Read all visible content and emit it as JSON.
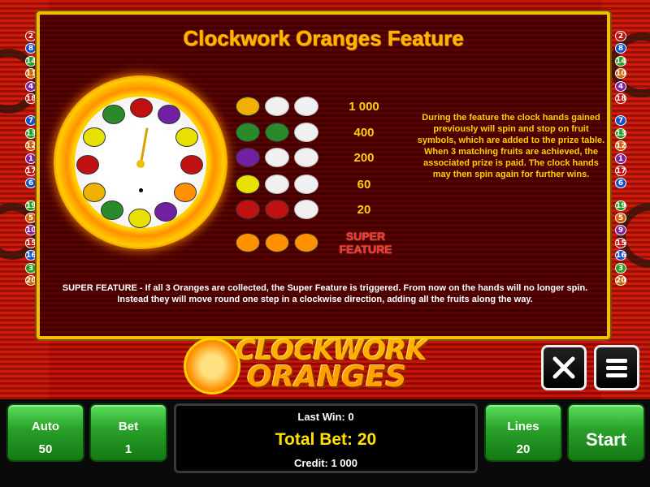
{
  "title": "Clockwork Oranges Feature",
  "lines_left": [
    "2",
    "8",
    "14",
    "11",
    "4",
    "18",
    "7",
    "13",
    "12",
    "1",
    "17",
    "6",
    "19",
    "5",
    "10",
    "15",
    "16",
    "3",
    "20"
  ],
  "lines_right": [
    "2",
    "8",
    "14",
    "10",
    "4",
    "18",
    "7",
    "13",
    "12",
    "1",
    "17",
    "6",
    "19",
    "5",
    "9",
    "15",
    "16",
    "3",
    "20"
  ],
  "paytable": [
    {
      "value": "1 000",
      "symbol": "orange-gold"
    },
    {
      "value": "400",
      "symbol": "watermelon"
    },
    {
      "value": "200",
      "symbol": "plum"
    },
    {
      "value": "60",
      "symbol": "lemon"
    },
    {
      "value": "20",
      "symbol": "cherry"
    }
  ],
  "super_feature_label": "SUPER FEATURE",
  "description": "During the feature the clock hands gained previously will spin and stop on fruit symbols, which are added to the prize table. When 3 matching fruits are achieved, the associated prize is paid. The clock hands may then spin again for further wins.",
  "super_description": "SUPER FEATURE - If all 3 Oranges are collected, the Super Feature is triggered. From now on the hands will no longer spin. Instead they will move round one step in a clockwise direction, adding all the fruits along the way.",
  "logo": {
    "line1": "CLOCKWORK",
    "line2": "ORANGES"
  },
  "buttons": {
    "auto_label": "Auto",
    "auto_value": "50",
    "bet_label": "Bet",
    "bet_value": "1",
    "lines_label": "Lines",
    "lines_value": "20",
    "start_label": "Start"
  },
  "info": {
    "last_win": "Last Win: 0",
    "total_bet": "Total Bet: 20",
    "credit": "Credit: 1 000"
  },
  "colors": {
    "panel_border": "#f0c000",
    "title": "#ffb400",
    "paytable_value": "#ffd000",
    "super_feature": "#ff3020",
    "button_green": "#28a028"
  },
  "icons": {
    "close": "close-icon",
    "menu": "menu-icon"
  }
}
